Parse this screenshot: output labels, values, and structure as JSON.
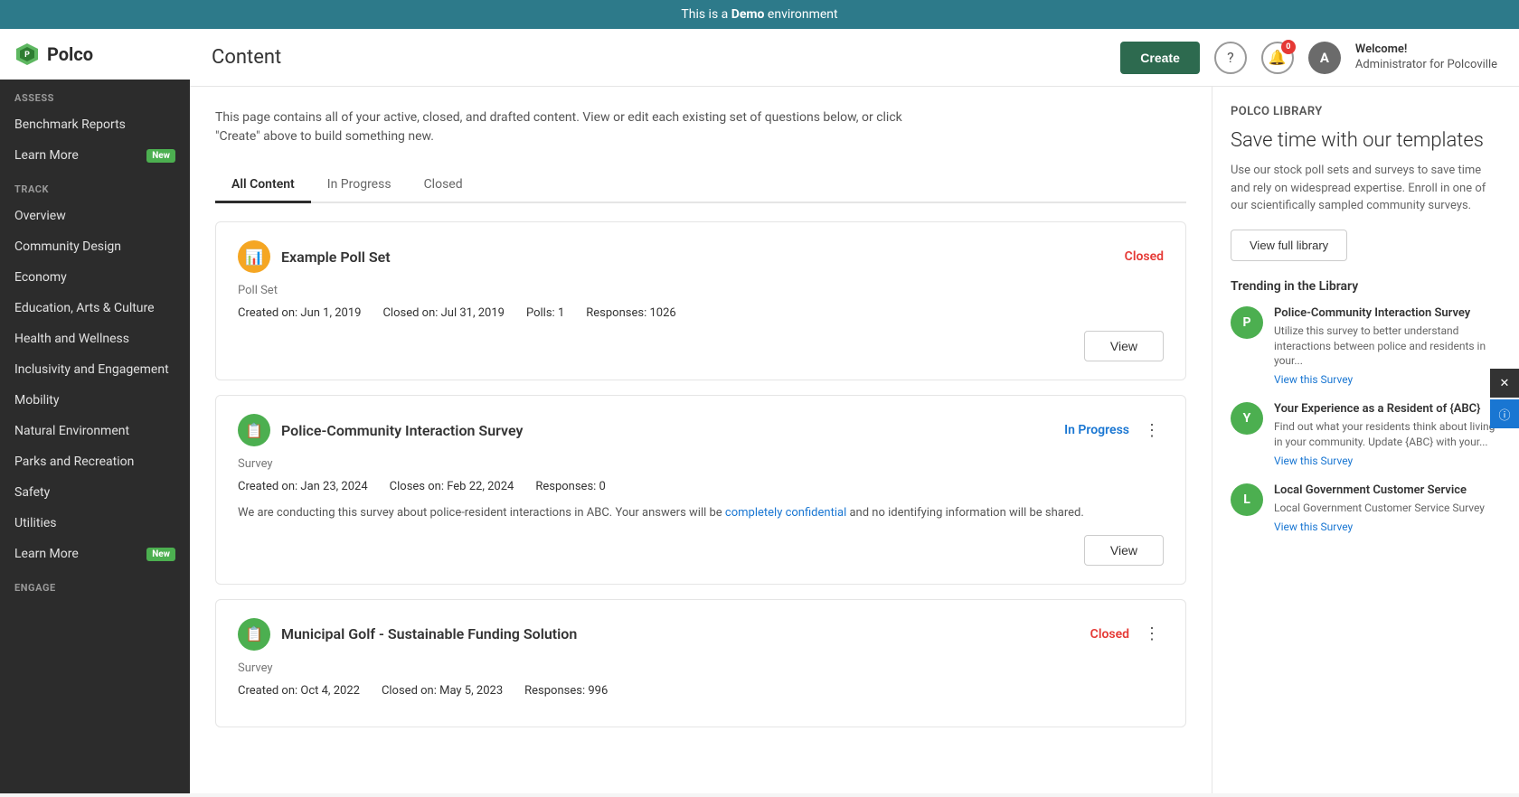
{
  "demoBanner": {
    "text": "This is a ",
    "boldText": "Demo",
    "suffix": " environment"
  },
  "sidebar": {
    "logo": "Polco",
    "sections": [
      {
        "header": "ASSESS",
        "items": [
          {
            "label": "Benchmark Reports",
            "badge": null
          },
          {
            "label": "Learn More",
            "badge": "New"
          }
        ]
      },
      {
        "header": "TRACK",
        "items": [
          {
            "label": "Overview",
            "badge": null
          },
          {
            "label": "Community Design",
            "badge": null
          },
          {
            "label": "Economy",
            "badge": null
          },
          {
            "label": "Education, Arts & Culture",
            "badge": null
          },
          {
            "label": "Health and Wellness",
            "badge": null
          },
          {
            "label": "Inclusivity and Engagement",
            "badge": null
          },
          {
            "label": "Mobility",
            "badge": null
          },
          {
            "label": "Natural Environment",
            "badge": null
          },
          {
            "label": "Parks and Recreation",
            "badge": null
          },
          {
            "label": "Safety",
            "badge": null
          },
          {
            "label": "Utilities",
            "badge": null
          },
          {
            "label": "Learn More",
            "badge": "New"
          }
        ]
      },
      {
        "header": "ENGAGE",
        "items": []
      }
    ]
  },
  "header": {
    "pageTitle": "Content",
    "createLabel": "Create",
    "welcomeTitle": "Welcome!",
    "welcomeSub": "Administrator for Polcoville",
    "notifCount": "0"
  },
  "pageDescription": "This page contains all of your active, closed, and drafted content. View or edit each existing set of questions below, or click \"Create\" above to build something new.",
  "tabs": [
    {
      "label": "All Content",
      "active": true
    },
    {
      "label": "In Progress",
      "active": false
    },
    {
      "label": "Closed",
      "active": false
    }
  ],
  "contentCards": [
    {
      "id": "example-poll-set",
      "icon": "📊",
      "iconColor": "orange",
      "title": "Example Poll Set",
      "type": "Poll Set",
      "status": "Closed",
      "statusType": "closed",
      "createdLabel": "Created on:",
      "createdDate": "Jun 1, 2019",
      "closedLabel": "Closed on:",
      "closedDate": "Jul 31, 2019",
      "pollsLabel": "Polls:",
      "pollsCount": "1",
      "responsesLabel": "Responses:",
      "responsesCount": "1026",
      "description": "",
      "viewLabel": "View",
      "hasMenu": false
    },
    {
      "id": "police-survey",
      "icon": "📋",
      "iconColor": "green",
      "title": "Police-Community Interaction Survey",
      "type": "Survey",
      "status": "In Progress",
      "statusType": "inprogress",
      "createdLabel": "Created on:",
      "createdDate": "Jan 23, 2024",
      "closedLabel": "Closes on:",
      "closedDate": "Feb 22, 2024",
      "responsesLabel": "Responses:",
      "responsesCount": "0",
      "description": "We are conducting this survey about police-resident interactions in ABC. Your answers will be completely confidential and no identifying information will be shared.",
      "viewLabel": "View",
      "hasMenu": true
    },
    {
      "id": "municipal-golf",
      "icon": "📋",
      "iconColor": "green",
      "title": "Municipal Golf - Sustainable Funding Solution",
      "type": "Survey",
      "status": "Closed",
      "statusType": "closed",
      "createdLabel": "Created on:",
      "createdDate": "Oct 4, 2022",
      "closedLabel": "Closed on:",
      "closedDate": "May 5, 2023",
      "responsesLabel": "Responses:",
      "responsesCount": "996",
      "description": "",
      "viewLabel": "View",
      "hasMenu": true
    }
  ],
  "rightPanel": {
    "libraryLabel": "Polco Library",
    "saveTimeHeading": "Save time with our templates",
    "saveTimeDesc": "Use our stock poll sets and surveys to save time and rely on widespread expertise. Enroll in one of our scientifically sampled community surveys.",
    "viewLibraryLabel": "View full library",
    "trendingLabel": "Trending in the Library",
    "trendingItems": [
      {
        "title": "Police-Community Interaction Survey",
        "description": "Utilize this survey to better understand interactions between police and residents in your...",
        "linkLabel": "View this Survey"
      },
      {
        "title": "Your Experience as a Resident of {ABC}",
        "description": "Find out what your residents think about living in your community. Update {ABC} with your...",
        "linkLabel": "View this Survey"
      },
      {
        "title": "Local Government Customer Service",
        "description": "Local Government Customer Service Survey",
        "linkLabel": "View this Survey"
      }
    ]
  }
}
